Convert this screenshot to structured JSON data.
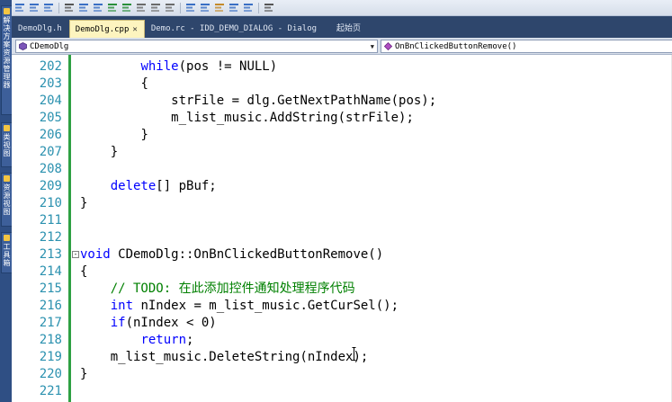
{
  "sidebar": {
    "tabs": [
      {
        "label": "解决方案资源管理器"
      },
      {
        "label": "类视图"
      },
      {
        "label": "资源视图"
      },
      {
        "label": "工具箱"
      }
    ]
  },
  "toolbar": {
    "buttons": [
      "align-left-icon",
      "align-top-icon",
      "align-right-icon",
      "text-icon",
      "center-vertical-icon",
      "center-horizontal-icon",
      "space-across-icon",
      "space-down-icon",
      "same-width-icon",
      "same-height-icon",
      "same-size-icon",
      "grid-icon",
      "ruler-icon",
      "guide-icon",
      "tab-order-icon",
      "test-dialog-icon",
      "more-icon"
    ]
  },
  "tabs": [
    {
      "label": "DemoDlg.h",
      "active": false
    },
    {
      "label": "DemoDlg.cpp",
      "active": true
    },
    {
      "label": "Demo.rc - IDD_DEMO_DIALOG - Dialog",
      "active": false
    },
    {
      "label": "起始页",
      "active": false
    }
  ],
  "nav": {
    "class_combo": "CDemoDlg",
    "member_combo": "OnBnClickedButtonRemove()"
  },
  "code": {
    "lines": [
      {
        "num": "202",
        "indent": "        ",
        "parts": [
          [
            "kw",
            "while"
          ],
          [
            "",
            "(pos != NULL)"
          ]
        ]
      },
      {
        "num": "203",
        "indent": "        ",
        "parts": [
          [
            "",
            "{"
          ]
        ]
      },
      {
        "num": "204",
        "indent": "            ",
        "parts": [
          [
            "",
            "strFile = dlg.GetNextPathName(pos);"
          ]
        ]
      },
      {
        "num": "205",
        "indent": "            ",
        "parts": [
          [
            "",
            "m_list_music.AddString(strFile);"
          ]
        ]
      },
      {
        "num": "206",
        "indent": "        ",
        "parts": [
          [
            "",
            "}"
          ]
        ]
      },
      {
        "num": "207",
        "indent": "    ",
        "parts": [
          [
            "",
            "}"
          ]
        ]
      },
      {
        "num": "208",
        "indent": "",
        "parts": []
      },
      {
        "num": "209",
        "indent": "    ",
        "parts": [
          [
            "kw",
            "delete"
          ],
          [
            "",
            "[] pBuf;"
          ]
        ]
      },
      {
        "num": "210",
        "indent": "",
        "parts": [
          [
            "",
            "}"
          ]
        ]
      },
      {
        "num": "211",
        "indent": "",
        "parts": []
      },
      {
        "num": "212",
        "indent": "",
        "parts": []
      },
      {
        "num": "213",
        "indent": "",
        "fold": "-",
        "parts": [
          [
            "kw",
            "void"
          ],
          [
            "",
            " CDemoDlg::OnBnClickedButtonRemove()"
          ]
        ]
      },
      {
        "num": "214",
        "indent": "",
        "parts": [
          [
            "",
            "{"
          ]
        ]
      },
      {
        "num": "215",
        "indent": "    ",
        "parts": [
          [
            "cm",
            "// TODO: 在此添加控件通知处理程序代码"
          ]
        ]
      },
      {
        "num": "216",
        "indent": "    ",
        "parts": [
          [
            "kw",
            "int"
          ],
          [
            "",
            " nIndex = m_list_music.GetCurSel();"
          ]
        ]
      },
      {
        "num": "217",
        "indent": "    ",
        "parts": [
          [
            "kw",
            "if"
          ],
          [
            "",
            "(nIndex < 0)"
          ]
        ]
      },
      {
        "num": "218",
        "indent": "        ",
        "parts": [
          [
            "kw",
            "return"
          ],
          [
            "",
            ";"
          ]
        ]
      },
      {
        "num": "219",
        "indent": "    ",
        "parts": [
          [
            "",
            "m_list_music.DeleteString(nIndex);"
          ]
        ]
      },
      {
        "num": "220",
        "indent": "",
        "parts": [
          [
            "",
            "}"
          ]
        ]
      },
      {
        "num": "221",
        "indent": "",
        "parts": []
      }
    ]
  }
}
